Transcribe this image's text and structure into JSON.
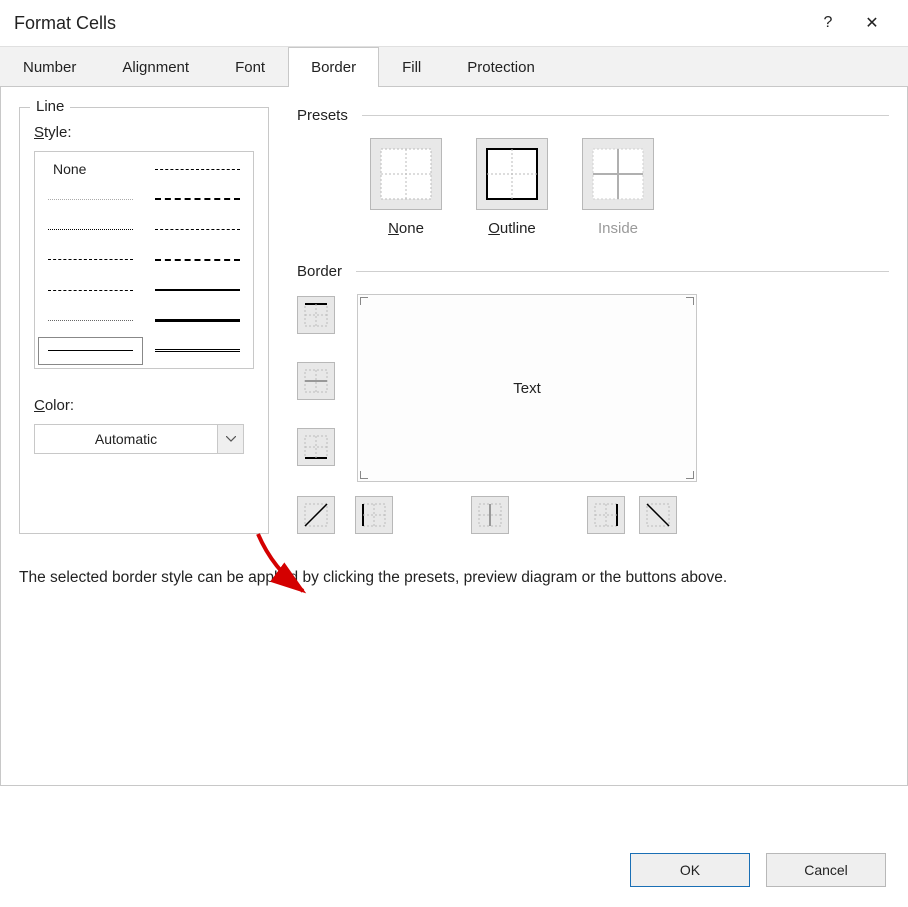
{
  "title": "Format Cells",
  "help_icon": "?",
  "close_icon": "✕",
  "tabs": [
    {
      "label": "Number",
      "active": false
    },
    {
      "label": "Alignment",
      "active": false
    },
    {
      "label": "Font",
      "active": false
    },
    {
      "label": "Border",
      "active": true
    },
    {
      "label": "Fill",
      "active": false
    },
    {
      "label": "Protection",
      "active": false
    }
  ],
  "line_group": {
    "title": "Line",
    "style_label": "Style:",
    "options": {
      "none": "None"
    },
    "color_label": "Color:",
    "color_value": "Automatic"
  },
  "presets": {
    "title": "Presets",
    "items": [
      {
        "id": "none",
        "label": "None",
        "underline": "N",
        "disabled": false
      },
      {
        "id": "outline",
        "label": "Outline",
        "underline": "O",
        "disabled": false
      },
      {
        "id": "inside",
        "label": "Inside",
        "underline": "",
        "disabled": true
      }
    ]
  },
  "border": {
    "title": "Border",
    "preview_text": "Text",
    "side_buttons": [
      {
        "id": "top",
        "name": "border-top-button"
      },
      {
        "id": "horiz",
        "name": "border-horizontal-button"
      },
      {
        "id": "bottom",
        "name": "border-bottom-button"
      }
    ],
    "bottom_buttons": [
      {
        "id": "diag-up",
        "name": "border-diagonal-up-button"
      },
      {
        "id": "left",
        "name": "border-left-button"
      },
      {
        "id": "vert",
        "name": "border-vertical-button"
      },
      {
        "id": "right",
        "name": "border-right-button"
      },
      {
        "id": "diag-down",
        "name": "border-diagonal-down-button"
      }
    ]
  },
  "description": "The selected border style can be applied by clicking the presets, preview diagram or the buttons above.",
  "buttons": {
    "ok": "OK",
    "cancel": "Cancel"
  },
  "annotation": {
    "type": "arrow",
    "color": "#d40000",
    "target": "border-diagonal-up-button"
  }
}
